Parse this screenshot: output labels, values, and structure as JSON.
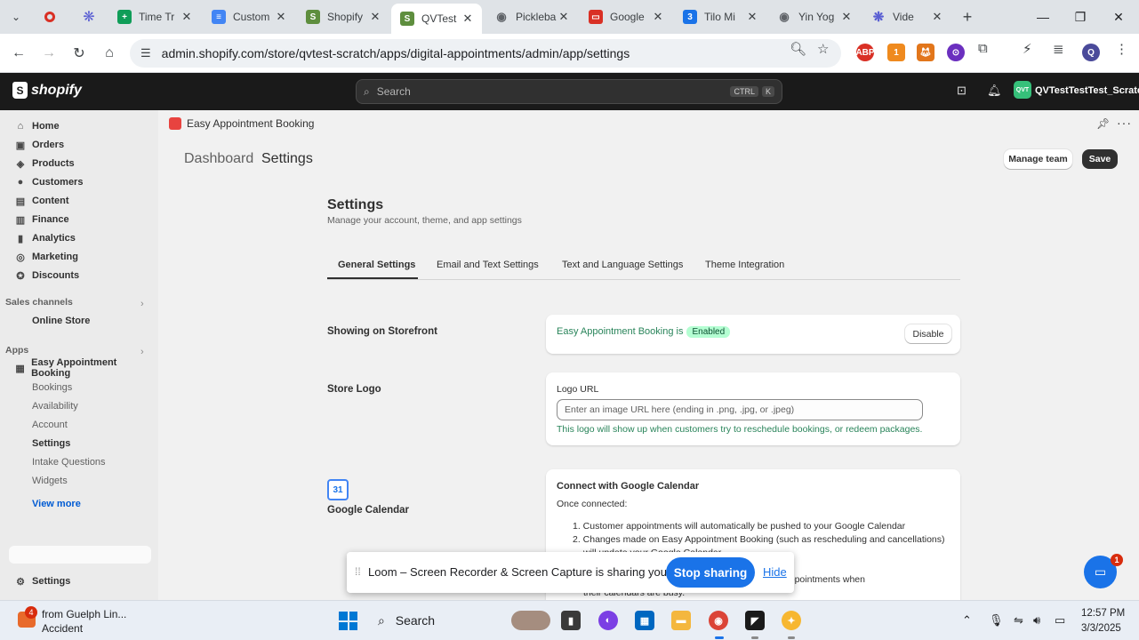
{
  "browser": {
    "tabs": [
      {
        "title": "Time Tr",
        "favicon": "google-sheets-icon",
        "color": "#0f9d58"
      },
      {
        "title": "Custom",
        "favicon": "google-docs-icon",
        "color": "#4285f4"
      },
      {
        "title": "Shopify",
        "favicon": "shopify-icon",
        "color": "#5e8e3e"
      },
      {
        "title": "QVTest",
        "favicon": "shopify-icon",
        "color": "#5e8e3e"
      },
      {
        "title": "Pickleba",
        "favicon": "globe-icon",
        "color": "#5f6368"
      },
      {
        "title": "Google",
        "favicon": "google-slides-icon",
        "color": "#d93025"
      },
      {
        "title": "Tilo Mi",
        "favicon": "number-3-icon",
        "color": "#1a73e8"
      },
      {
        "title": "Yin Yog",
        "favicon": "globe-icon",
        "color": "#5f6368"
      },
      {
        "title": "Vide",
        "favicon": "asterisk-icon",
        "color": "#5a5fd3"
      }
    ],
    "url": "admin.shopify.com/store/qvtest-scratch/apps/digital-appointments/admin/app/settings",
    "profile_initial": "Q"
  },
  "shopify": {
    "logo_text": "shopify",
    "search_placeholder": "Search",
    "kbd_ctrl": "CTRL",
    "kbd_k": "K",
    "store_avatar": "QVT",
    "store_name": "QVTestTestTest_Scratch"
  },
  "sidebar": {
    "items": [
      {
        "label": "Home",
        "icon": "home-icon"
      },
      {
        "label": "Orders",
        "icon": "orders-icon"
      },
      {
        "label": "Products",
        "icon": "tag-icon"
      },
      {
        "label": "Customers",
        "icon": "person-icon"
      },
      {
        "label": "Content",
        "icon": "content-icon"
      },
      {
        "label": "Finance",
        "icon": "bank-icon"
      },
      {
        "label": "Analytics",
        "icon": "chart-icon"
      },
      {
        "label": "Marketing",
        "icon": "target-icon"
      },
      {
        "label": "Discounts",
        "icon": "discount-icon"
      }
    ],
    "sales_channels_label": "Sales channels",
    "online_store_label": "Online Store",
    "apps_label": "Apps",
    "app_label": "Easy Appointment Booking",
    "app_subitems": [
      "Bookings",
      "Availability",
      "Account",
      "Settings",
      "Intake Questions",
      "Widgets"
    ],
    "view_more": "View more",
    "settings_label": "Settings"
  },
  "main": {
    "app_name": "Easy Appointment Booking",
    "breadcrumb_dashboard": "Dashboard",
    "breadcrumb_settings": "Settings",
    "manage_team": "Manage team",
    "save": "Save",
    "title": "Settings",
    "subtitle": "Manage your account, theme, and app settings",
    "tabs": [
      "General Settings",
      "Email and Text Settings",
      "Text and Language Settings",
      "Theme Integration"
    ],
    "storefront": {
      "label": "Showing on Storefront",
      "status_text": "Easy Appointment Booking is",
      "badge": "Enabled",
      "button": "Disable"
    },
    "logo": {
      "label": "Store Logo",
      "field_label": "Logo URL",
      "placeholder": "Enter an image URL here (ending in .png, .jpg, or .jpeg)",
      "help": "This logo will show up when customers try to reschedule bookings, or redeem packages."
    },
    "gcal": {
      "icon_text": "31",
      "label": "Google Calendar",
      "title": "Connect with Google Calendar",
      "once": "Once connected:",
      "items": [
        "1.  Customer appointments will automatically be pushed to your Google Calendar",
        "2.  Changes made on Easy Appointment Booking (such as rescheduling and cancellations)",
        "will update your Google Calendar",
        "3.  Staff members will be marked as unavailable for appointments when",
        "their calendars are busy."
      ]
    }
  },
  "loom": {
    "message": "Loom – Screen Recorder & Screen Capture is sharing your screen.",
    "stop": "Stop sharing",
    "hide": "Hide"
  },
  "help": {
    "badge": "1"
  },
  "taskbar": {
    "weather_badge": "4",
    "weather_line1": "from Guelph Lin...",
    "weather_line2": "Accident",
    "search": "Search",
    "time": "12:57 PM",
    "date": "3/3/2025"
  }
}
